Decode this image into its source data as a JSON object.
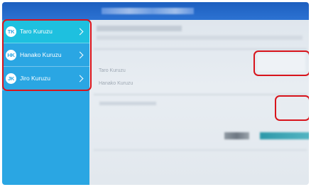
{
  "sidebar": {
    "items": [
      {
        "initials": "TK",
        "label": "Taro Kuruzu",
        "active": true
      },
      {
        "initials": "HK",
        "label": "Hanako Kuruzu",
        "active": false
      },
      {
        "initials": "JK",
        "label": "Jiro Kuruzu",
        "active": false
      }
    ]
  },
  "content": {
    "field_1_label": "Taro Kuruzu",
    "field_2_label": "Hanako Kuruzu"
  },
  "colors": {
    "header": "#2c72d2",
    "sidebar": "#2aa6e3",
    "active_item": "#1ec0df",
    "highlight": "#d8141c",
    "primary_button": "#2c98a9"
  }
}
